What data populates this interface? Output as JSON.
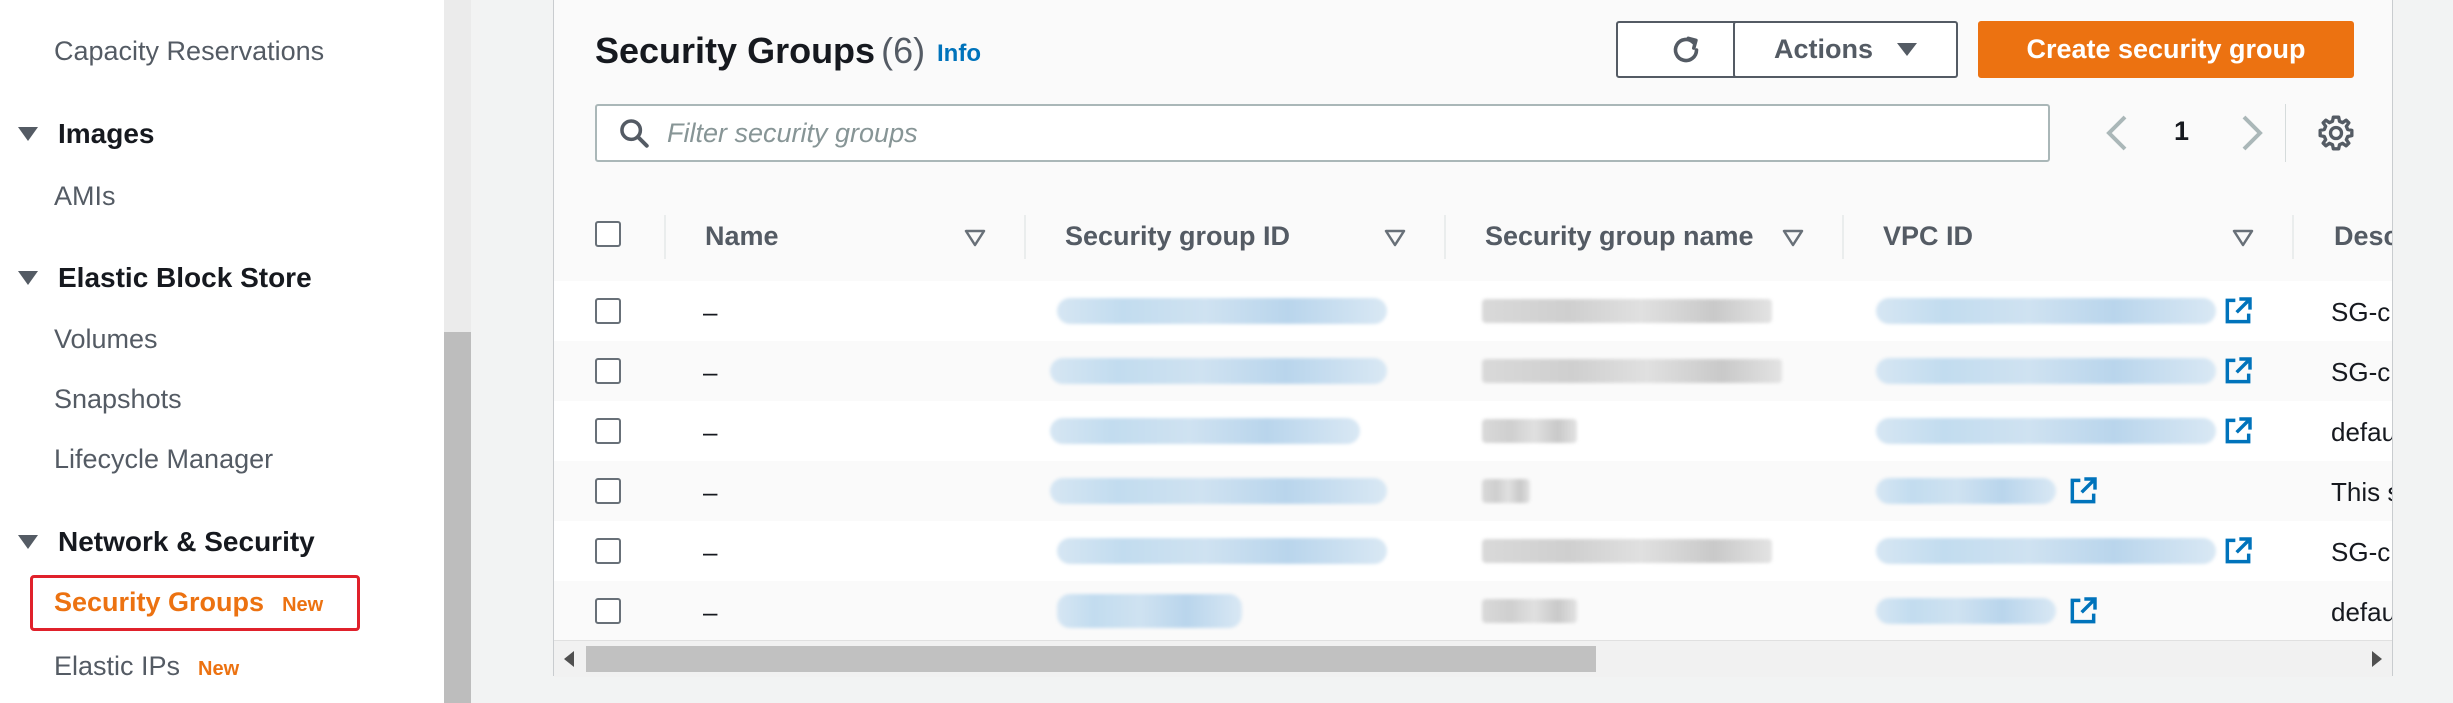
{
  "sidebar": {
    "capacity_reservations": "Capacity Reservations",
    "images_section": "Images",
    "amis": "AMIs",
    "ebs_section": "Elastic Block Store",
    "volumes": "Volumes",
    "snapshots": "Snapshots",
    "lifecycle_manager": "Lifecycle Manager",
    "network_section": "Network & Security",
    "security_groups": "Security Groups",
    "security_groups_badge": "New",
    "elastic_ips": "Elastic IPs",
    "elastic_ips_badge": "New"
  },
  "header": {
    "title": "Security Groups",
    "count": "(6)",
    "info": "Info",
    "actions_label": "Actions",
    "create_label": "Create security group"
  },
  "search": {
    "placeholder": "Filter security groups"
  },
  "pager": {
    "current_page": "1"
  },
  "table": {
    "columns": [
      "Name",
      "Security group ID",
      "Security group name",
      "VPC ID",
      "Desc"
    ],
    "rows": [
      {
        "name": "–",
        "description": "SG-cl"
      },
      {
        "name": "–",
        "description": "SG-cl"
      },
      {
        "name": "–",
        "description": "defau"
      },
      {
        "name": "–",
        "description": "This s"
      },
      {
        "name": "–",
        "description": "SG-cl"
      },
      {
        "name": "–",
        "description": "defau"
      }
    ]
  },
  "colors": {
    "accent": "#ec7211",
    "link": "#0073bb",
    "highlight_border": "#e0212b"
  },
  "icons": [
    "refresh-icon",
    "caret-down-icon",
    "search-icon",
    "chevron-left-icon",
    "chevron-right-icon",
    "gear-icon",
    "sort-icon",
    "external-link-icon"
  ]
}
